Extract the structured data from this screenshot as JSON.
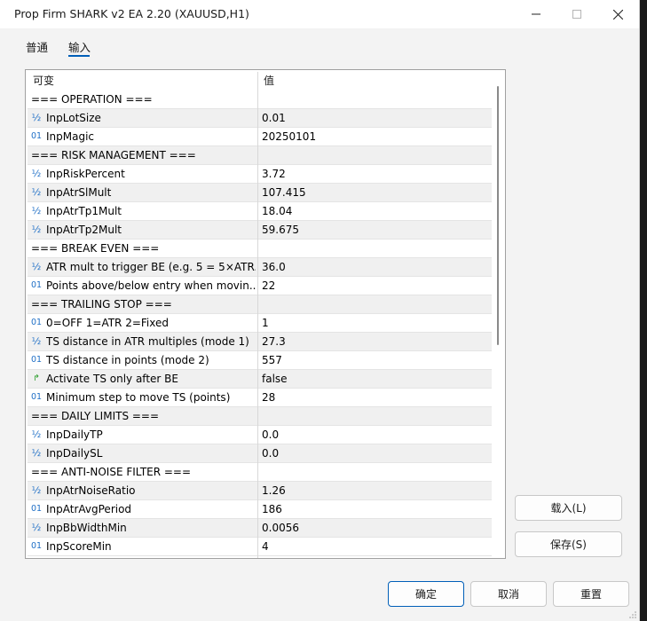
{
  "window": {
    "title": "Prop Firm SHARK v2 EA 2.20 (XAUUSD,H1)",
    "controls": {
      "minimize": "—",
      "maximize": "☐",
      "close": "✕"
    }
  },
  "tabs": [
    {
      "label": "普通",
      "active": false
    },
    {
      "label": "输入",
      "active": true
    }
  ],
  "table": {
    "headers": {
      "variable": "可变",
      "value": "值"
    },
    "rows": [
      {
        "type": "section",
        "name": "=== OPERATION ===",
        "value": ""
      },
      {
        "type": "double",
        "icon": "½",
        "name": "InpLotSize",
        "value": "0.01"
      },
      {
        "type": "int",
        "icon": "01",
        "name": "InpMagic",
        "value": "20250101"
      },
      {
        "type": "section",
        "name": "=== RISK MANAGEMENT ===",
        "value": ""
      },
      {
        "type": "double",
        "icon": "½",
        "name": "InpRiskPercent",
        "value": "3.72"
      },
      {
        "type": "double",
        "icon": "½",
        "name": "InpAtrSlMult",
        "value": "107.415"
      },
      {
        "type": "double",
        "icon": "½",
        "name": "InpAtrTp1Mult",
        "value": "18.04"
      },
      {
        "type": "double",
        "icon": "½",
        "name": "InpAtrTp2Mult",
        "value": "59.675"
      },
      {
        "type": "section",
        "name": "=== BREAK EVEN ===",
        "value": ""
      },
      {
        "type": "double",
        "icon": "½",
        "name": "ATR mult to trigger BE (e.g. 5 = 5×ATR...",
        "value": "36.0"
      },
      {
        "type": "int",
        "icon": "01",
        "name": "Points above/below entry when movin...",
        "value": "22"
      },
      {
        "type": "section",
        "name": "=== TRAILING STOP ===",
        "value": ""
      },
      {
        "type": "int",
        "icon": "01",
        "name": "0=OFF  1=ATR  2=Fixed",
        "value": "1"
      },
      {
        "type": "double",
        "icon": "½",
        "name": "TS distance in ATR multiples (mode 1)",
        "value": "27.3"
      },
      {
        "type": "int",
        "icon": "01",
        "name": "TS distance in points (mode 2)",
        "value": "557"
      },
      {
        "type": "bool",
        "icon": "↱",
        "name": "Activate TS only after BE",
        "value": "false"
      },
      {
        "type": "int",
        "icon": "01",
        "name": "Minimum step to move TS (points)",
        "value": "28"
      },
      {
        "type": "section",
        "name": "=== DAILY LIMITS ===",
        "value": ""
      },
      {
        "type": "double",
        "icon": "½",
        "name": "InpDailyTP",
        "value": "0.0"
      },
      {
        "type": "double",
        "icon": "½",
        "name": "InpDailySL",
        "value": "0.0"
      },
      {
        "type": "section",
        "name": "=== ANTI-NOISE FILTER ===",
        "value": ""
      },
      {
        "type": "double",
        "icon": "½",
        "name": "InpAtrNoiseRatio",
        "value": "1.26"
      },
      {
        "type": "int",
        "icon": "01",
        "name": "InpAtrAvgPeriod",
        "value": "186"
      },
      {
        "type": "double",
        "icon": "½",
        "name": "InpBbWidthMin",
        "value": "0.0056"
      },
      {
        "type": "int",
        "icon": "01",
        "name": "InpScoreMin",
        "value": "4"
      }
    ]
  },
  "side_buttons": {
    "load": "载入(L)",
    "save": "保存(S)"
  },
  "footer_buttons": {
    "ok": "确定",
    "cancel": "取消",
    "reset": "重置"
  },
  "colors": {
    "accent": "#005fb8",
    "icon_blue": "#1f6fc6",
    "bool_green": "#2a9d2a"
  }
}
